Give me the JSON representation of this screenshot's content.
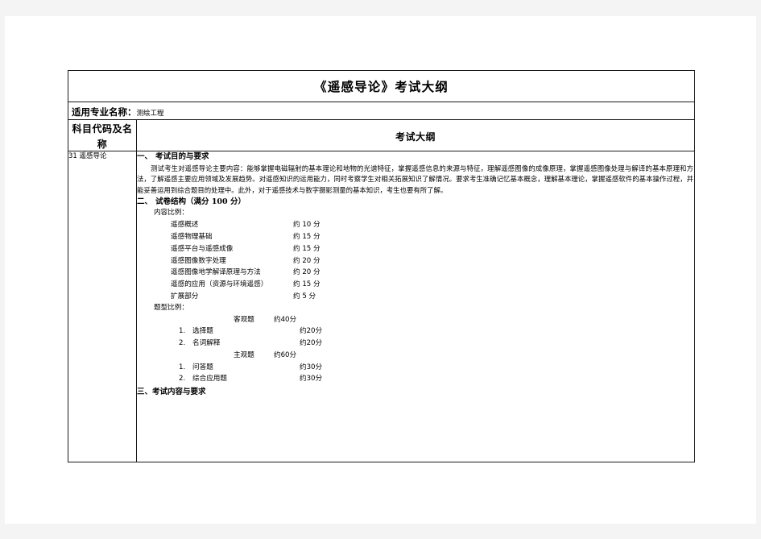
{
  "document": {
    "title": "《遥感导论》考试大纲",
    "major_label": "适用专业名称：",
    "major_value": "测绘工程",
    "column_headers": {
      "subject": "科目代码及名称",
      "syllabus": "考试大纲"
    },
    "subject_code_name": "31 遥感导论"
  },
  "sections": {
    "one": {
      "num": "一、",
      "title": "考试目的与要求",
      "paragraph": "测试考生对遥感导论主要内容：能够掌握电磁辐射的基本理论和地物的光谱特征，掌握遥感信息的来源与特征，理解遥感图像的成像原理，掌握遥感图像处理与解译的基本原理和方法，了解遥感主要应用领域及发展趋势。对遥感知识的运用能力，同时考察学生对相关拓展知识了解情况。要求考生准确记忆基本概念，理解基本理论，掌握遥感软件的基本操作过程，并能妥善运用到综合题目的处理中。此外，对于遥感技术与数字摄影测量的基本知识，考生也要有所了解。"
    },
    "two": {
      "num": "二、",
      "title": "试卷结构（满分 100 分）",
      "content_label": "内容比例：",
      "content_items": [
        {
          "name": "遥感概述",
          "score": "约 10 分"
        },
        {
          "name": "遥感物理基础",
          "score": "约 15 分"
        },
        {
          "name": "遥感平台与遥感成像",
          "score": "约 15 分"
        },
        {
          "name": "遥感图像数字处理",
          "score": "约 20 分"
        },
        {
          "name": "遥感图像地学解译原理与方法",
          "score": "约 20 分"
        },
        {
          "name": "遥感的应用（资源与环境遥感）",
          "score": "约 15 分"
        },
        {
          "name": "扩展部分",
          "score": "约 5 分"
        }
      ],
      "question_type_label": "题型比例：",
      "objective": {
        "name": "客观题",
        "score": "约40分"
      },
      "objective_items": [
        {
          "index": "1.",
          "name": "选择题",
          "score": "约20分"
        },
        {
          "index": "2.",
          "name": "名词解释",
          "score": "约20分"
        }
      ],
      "subjective": {
        "name": "主观题",
        "score": "约60分"
      },
      "subjective_items": [
        {
          "index": "1.",
          "name": "问答题",
          "score": "约30分"
        },
        {
          "index": "2.",
          "name": "综合应用题",
          "score": "约30分"
        }
      ]
    },
    "three": {
      "num": "三、",
      "title": "考试内容与要求"
    }
  }
}
